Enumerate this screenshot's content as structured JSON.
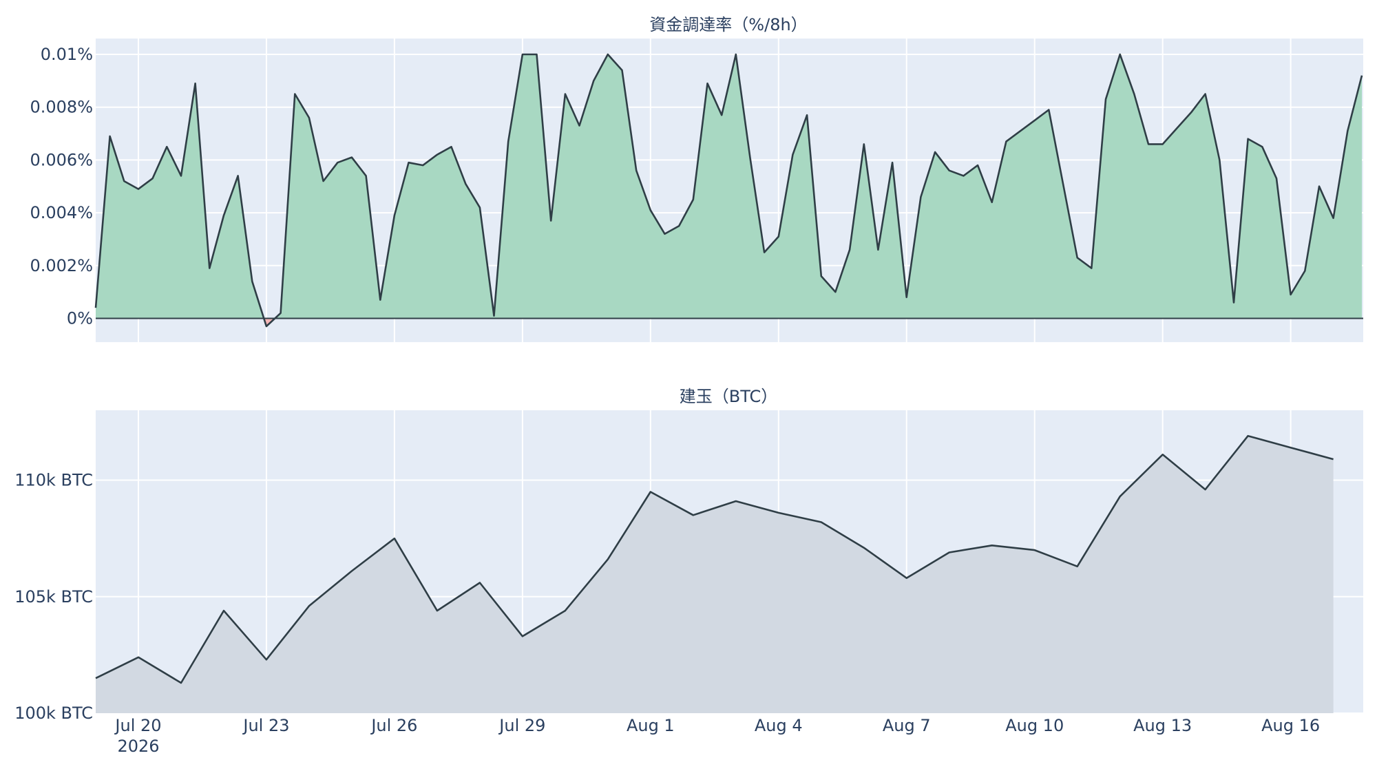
{
  "colors": {
    "plot_bg": "#e5ecf6",
    "grid": "#ffffff",
    "line": "#2f3e46",
    "funding_positive_fill": "#a8d8c2",
    "funding_negative_fill": "#f4b6b6",
    "oi_fill": "#d2d9e2",
    "text": "#2a3f5f"
  },
  "chart_data": [
    {
      "type": "area",
      "title": "資金調達率（%/8h）",
      "x_unit": "days from Jul 19 2026",
      "xlim": [
        0,
        29.7
      ],
      "ylim": [
        -0.0009,
        0.0106
      ],
      "y_ticks": [
        0,
        0.002,
        0.004,
        0.006,
        0.008,
        0.01
      ],
      "y_tick_labels": [
        "0%",
        "0.002%",
        "0.004%",
        "0.006%",
        "0.008%",
        "0.01%"
      ],
      "x_ticks": [
        1,
        4,
        7,
        10,
        13,
        16,
        19,
        22,
        25,
        28
      ],
      "x_tick_labels": [],
      "x": [
        0,
        0.333,
        0.667,
        1,
        1.333,
        1.667,
        2,
        2.333,
        2.667,
        3,
        3.333,
        3.667,
        4,
        4.333,
        4.667,
        5,
        5.333,
        5.667,
        6,
        6.333,
        6.667,
        7,
        7.333,
        7.667,
        8,
        8.333,
        8.667,
        9,
        9.333,
        9.667,
        10,
        10.333,
        10.667,
        11,
        11.333,
        11.667,
        12,
        12.333,
        12.667,
        13,
        13.333,
        13.667,
        14,
        14.333,
        14.667,
        15,
        15.333,
        15.667,
        16,
        16.333,
        16.667,
        17,
        17.333,
        17.667,
        18,
        18.333,
        18.667,
        19,
        19.333,
        19.667,
        20,
        20.333,
        20.667,
        21,
        21.333,
        21.667,
        22,
        22.333,
        22.667,
        23,
        23.333,
        23.667,
        24,
        24.333,
        24.667,
        25,
        25.333,
        25.667,
        26,
        26.333,
        26.667,
        27,
        27.333,
        27.667,
        28,
        28.333,
        28.667,
        29,
        29.333,
        29.667
      ],
      "values": [
        0.0004,
        0.0069,
        0.0052,
        0.0049,
        0.0053,
        0.0065,
        0.0054,
        0.0089,
        0.0019,
        0.0039,
        0.0054,
        0.0014,
        -0.0003,
        0.0002,
        0.0085,
        0.0076,
        0.0052,
        0.0059,
        0.0061,
        0.0054,
        0.0007,
        0.0039,
        0.0059,
        0.0058,
        0.0062,
        0.0065,
        0.0051,
        0.0042,
        0.0001,
        0.0067,
        0.01,
        0.01,
        0.0037,
        0.0085,
        0.0073,
        0.009,
        0.01,
        0.0094,
        0.0056,
        0.0041,
        0.0032,
        0.0035,
        0.0045,
        0.0089,
        0.0077,
        0.01,
        0.0061,
        0.0025,
        0.0031,
        0.0062,
        0.0077,
        0.0016,
        0.001,
        0.0026,
        0.0066,
        0.0026,
        0.0059,
        0.0008,
        0.0046,
        0.0063,
        0.0056,
        0.0054,
        0.0058,
        0.0044,
        0.0067,
        0.0071,
        0.0075,
        0.0079,
        0.0051,
        0.0023,
        0.0019,
        0.0083,
        0.01,
        0.0085,
        0.0066,
        0.0066,
        0.0072,
        0.0078,
        0.0085,
        0.006,
        0.0006,
        0.0068,
        0.0065,
        0.0053,
        0.0009,
        0.0018,
        0.005,
        0.0038,
        0.0071,
        0.0092
      ]
    },
    {
      "type": "area",
      "title": "建玉（BTC）",
      "x_unit": "days from Jul 19 2026",
      "xlim": [
        0,
        29.7
      ],
      "ylim": [
        100000,
        113000
      ],
      "y_ticks": [
        100000,
        105000,
        110000
      ],
      "y_tick_labels": [
        "100k BTC",
        "105k BTC",
        "110k BTC"
      ],
      "x_ticks": [
        1,
        4,
        7,
        10,
        13,
        16,
        19,
        22,
        25,
        28
      ],
      "x_tick_labels": [
        "Jul 20",
        "Jul 23",
        "Jul 26",
        "Jul 29",
        "Aug 1",
        "Aug 4",
        "Aug 7",
        "Aug 10",
        "Aug 13",
        "Aug 16"
      ],
      "x_year_label": "2026",
      "x": [
        0,
        1,
        2,
        3,
        4,
        5,
        6,
        7,
        8,
        9,
        10,
        11,
        12,
        13,
        14,
        15,
        16,
        17,
        18,
        19,
        20,
        21,
        22,
        23,
        24,
        25,
        26,
        27,
        28,
        29
      ],
      "values": [
        101500,
        102400,
        101300,
        104400,
        102300,
        104600,
        106100,
        107500,
        104400,
        105600,
        103300,
        104400,
        106600,
        109500,
        108500,
        109100,
        108600,
        108200,
        107100,
        105800,
        106900,
        107200,
        107000,
        106300,
        109300,
        111100,
        109600,
        111900,
        111400,
        110900
      ]
    }
  ]
}
